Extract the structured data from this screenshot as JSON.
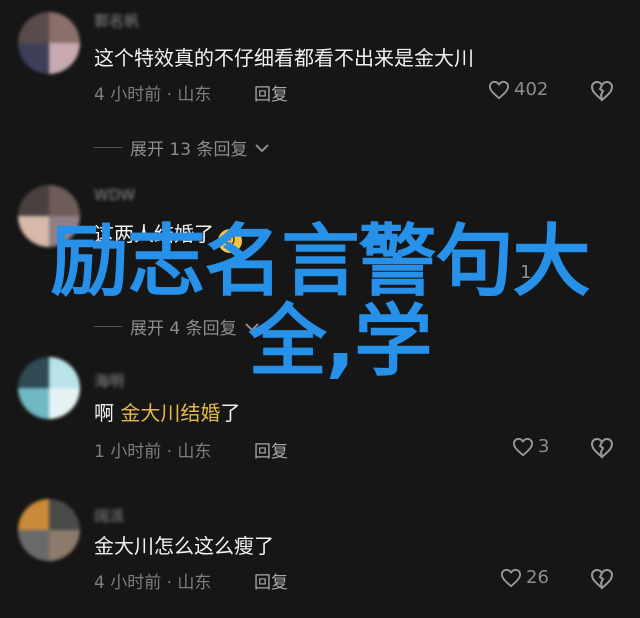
{
  "comments": [
    {
      "username": "郭名帆",
      "text": "这个特效真的不仔细看都看不出来是金大川",
      "meta": "4 小时前 · 山东",
      "reply": "回复",
      "likes": "402",
      "expand": "展开 13 条回复"
    },
    {
      "username": "WDW",
      "text": "这两人结婚了",
      "meta": "4 小时前 · 山东",
      "reply": "回复",
      "likes": "1",
      "expand": "展开 4 条回复"
    },
    {
      "username": "海明",
      "text_prefix": "啊",
      "mention": "金大川结婚",
      "text_suffix": "了",
      "meta": "1 小时前 · 山东",
      "reply": "回复",
      "likes": "3"
    },
    {
      "username": "阔派",
      "text": "金大川怎么这么瘦了",
      "meta": "4 小时前 · 山东",
      "reply": "回复",
      "likes": "26"
    }
  ],
  "overlay": {
    "line1": "励志名言警句大",
    "line2": "全,学"
  },
  "icons": {
    "like": "heart-outline-icon",
    "dislike": "broken-heart-icon",
    "chevron": "chevron-down-icon",
    "emoji": "surprised-emoji-icon"
  },
  "colors": {
    "background": "#161616",
    "overlay_text": "#2790e8",
    "mention": "#e6b84a"
  }
}
